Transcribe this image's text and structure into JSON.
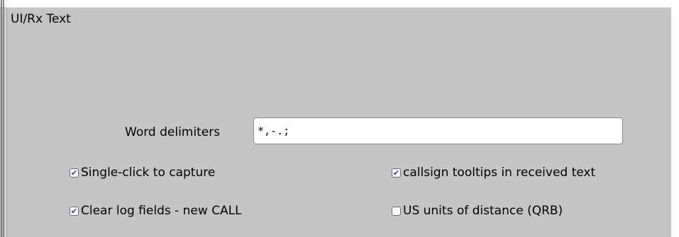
{
  "group": {
    "title": "UI/Rx Text"
  },
  "word_delimiters": {
    "label": "Word delimiters",
    "value": "*,-.;"
  },
  "checkboxes": [
    {
      "label": "Single-click to capture",
      "checked": true
    },
    {
      "label": "callsign tooltips in received text",
      "checked": true
    },
    {
      "label": "Clear log fields - new CALL",
      "checked": true
    },
    {
      "label": "US units of distance (QRB)",
      "checked": false
    }
  ],
  "colors": {
    "panel_background": "#c5c5c5",
    "checkmark": "#2244aa"
  },
  "icons": {
    "checked": "checkmark-icon"
  }
}
